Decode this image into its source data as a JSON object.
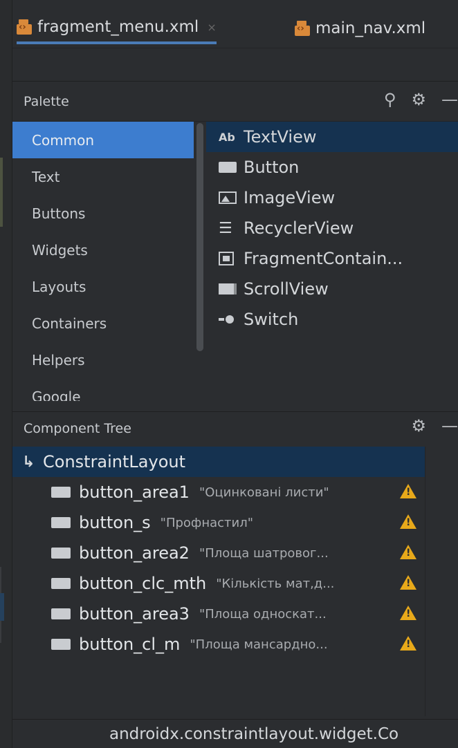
{
  "tabs": [
    {
      "label": "fragment_menu.xml",
      "close": "×",
      "active": true
    },
    {
      "label": "main_nav.xml",
      "active": false
    }
  ],
  "palette": {
    "title": "Palette",
    "icons": {
      "search": "search-icon",
      "settings": "gear-icon",
      "minimize": "minimize-icon"
    },
    "categories": [
      "Common",
      "Text",
      "Buttons",
      "Widgets",
      "Layouts",
      "Containers",
      "Helpers",
      "Google"
    ],
    "selected_category": "Common",
    "components": [
      {
        "icon": "textview-icon",
        "icon_text": "Ab",
        "label": "TextView"
      },
      {
        "icon": "button-icon",
        "label": "Button"
      },
      {
        "icon": "imageview-icon",
        "label": "ImageView"
      },
      {
        "icon": "list-icon",
        "icon_text": "☰",
        "label": "RecyclerView"
      },
      {
        "icon": "fragment-icon",
        "label": "FragmentContain..."
      },
      {
        "icon": "scrollview-icon",
        "label": "ScrollView"
      },
      {
        "icon": "switch-icon",
        "label": "Switch"
      }
    ]
  },
  "component_tree": {
    "title": "Component Tree",
    "root": {
      "icon": "constraint-icon",
      "icon_text": "↳",
      "label": "ConstraintLayout"
    },
    "items": [
      {
        "id": "button_area1",
        "text": "\"Оцинковані листи\""
      },
      {
        "id": "button_s",
        "text": "\"Профнастил\""
      },
      {
        "id": "button_area2",
        "text": "\"Площа шатровог..."
      },
      {
        "id": "button_clc_mth",
        "text": "\"Кількість мат,д..."
      },
      {
        "id": "button_area3",
        "text": "\"Площа односкат..."
      },
      {
        "id": "button_cl_m",
        "text": "\"Площа мансардно..."
      }
    ]
  },
  "status_bar": {
    "text": "androidx.constraintlayout.widget.Co"
  },
  "colors": {
    "selection": "#3d7dcf",
    "selected_row": "#153250",
    "warning": "#e8a91a",
    "xml_icon": "#d9893a"
  }
}
